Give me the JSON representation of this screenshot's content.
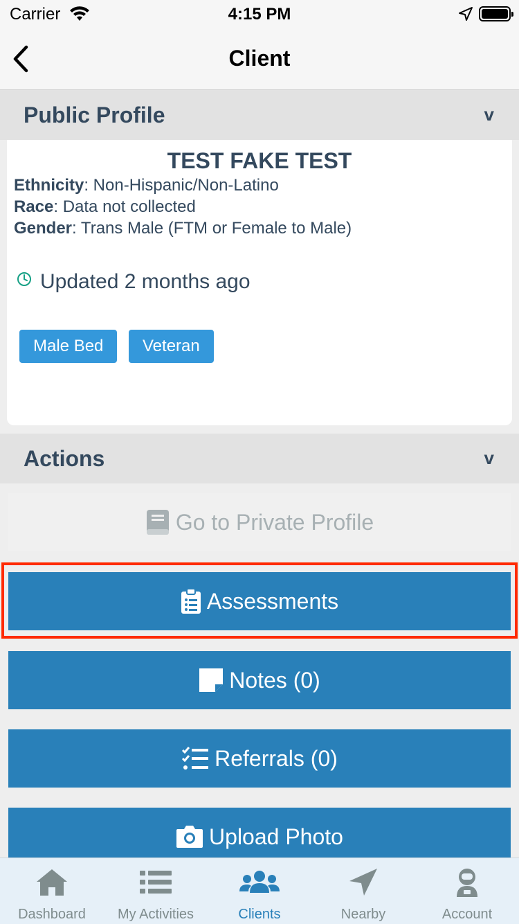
{
  "status_bar": {
    "carrier": "Carrier",
    "time": "4:15 PM"
  },
  "nav": {
    "title": "Client"
  },
  "public_profile": {
    "header": "Public Profile",
    "chevron": "v",
    "name": "TEST FAKE TEST",
    "fields": [
      {
        "label": "Ethnicity",
        "value": ": Non-Hispanic/Non-Latino"
      },
      {
        "label": "Race",
        "value": ": Data not collected"
      },
      {
        "label": "Gender",
        "value": ": Trans Male (FTM or Female to Male)"
      }
    ],
    "updated": "Updated 2 months ago",
    "tags": [
      "Male Bed",
      "Veteran"
    ]
  },
  "actions": {
    "header": "Actions",
    "chevron": "v",
    "buttons": [
      {
        "label": "Go to Private Profile",
        "icon": "book-icon",
        "enabled": false
      },
      {
        "label": "Assessments",
        "icon": "clipboard-list-icon",
        "enabled": true
      },
      {
        "label": "Notes (0)",
        "icon": "sticky-note-icon",
        "enabled": true
      },
      {
        "label": "Referrals (0)",
        "icon": "tasks-icon",
        "enabled": true
      },
      {
        "label": "Upload Photo",
        "icon": "camera-icon",
        "enabled": true
      }
    ]
  },
  "tabs": [
    {
      "label": "Dashboard",
      "icon": "home-icon",
      "active": false
    },
    {
      "label": "My Activities",
      "icon": "list-icon",
      "active": false
    },
    {
      "label": "Clients",
      "icon": "users-icon",
      "active": true
    },
    {
      "label": "Nearby",
      "icon": "location-arrow-icon",
      "active": false
    },
    {
      "label": "Account",
      "icon": "astronaut-icon",
      "active": false
    }
  ],
  "colors": {
    "primary": "#2980b9",
    "tag": "#3498db",
    "text": "#34495e",
    "highlight": "#ff2a00",
    "clock": "#16a085"
  }
}
